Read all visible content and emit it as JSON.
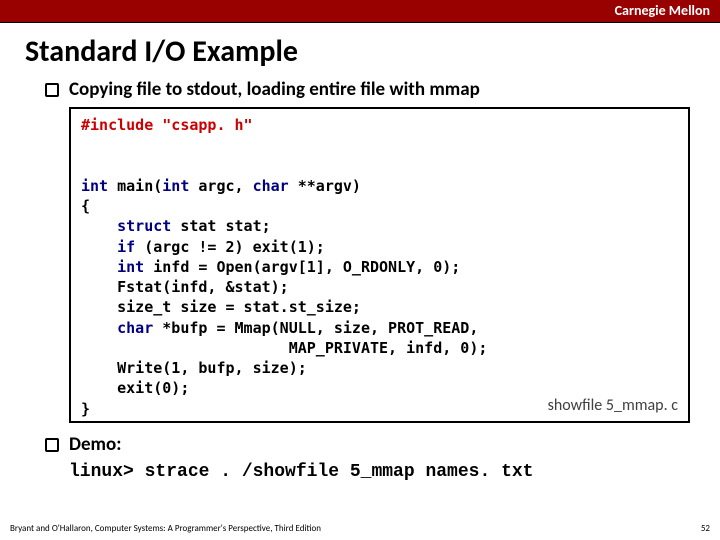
{
  "header": {
    "brand": "Carnegie Mellon"
  },
  "title": "Standard I/O Example",
  "bullets": {
    "b1": "Copying file to stdout, loading entire file with mmap",
    "b2": "Demo:"
  },
  "code": {
    "include_pre": "#include ",
    "include_file": "\"csapp. h\"",
    "kw_int1": "int",
    "main_sig_mid": " main(",
    "kw_int2": "int",
    "argc": " argc, ",
    "kw_char1": "char",
    "argv_end": " **argv)",
    "brace_open": "{",
    "kw_struct": "struct",
    "stat_line": " stat stat;",
    "kw_if": "if",
    "if_rest": " (argc != 2) exit(1);",
    "kw_int3": "int",
    "infd_rest": " infd = Open(argv[1], O_RDONLY, 0);",
    "fstat": "Fstat(infd, &stat);",
    "sizet": "size_t size = stat.st_size;",
    "kw_char2": "char",
    "bufp_rest": " *bufp = Mmap(NULL, size, PROT_READ,",
    "mmap_cont": "MAP_PRIVATE, infd, 0);",
    "write": "Write(1, bufp, size);",
    "exit0": "exit(0);",
    "brace_close": "}",
    "filename": "showfile 5_mmap. c"
  },
  "demo_cmd": "linux> strace . /showfile 5_mmap names. txt",
  "footer": {
    "left": "Bryant and O'Hallaron, Computer Systems: A Programmer's Perspective, Third Edition",
    "page": "52"
  }
}
